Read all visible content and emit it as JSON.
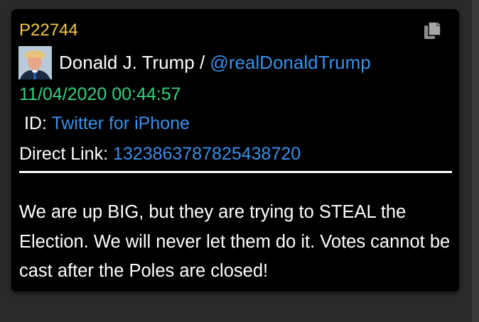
{
  "post": {
    "id": "P22744",
    "author_name": "Donald J. Trump",
    "author_separator": " / ",
    "handle": "@realDonaldTrump",
    "timestamp": "11/04/2020 00:44:57",
    "id_label": " ID: ",
    "id_value": "Twitter for iPhone",
    "direct_link_label": "Direct Link: ",
    "direct_link_value": "1323863787825438720",
    "body": "We are up BIG, but they are trying to STEAL the Election. We will never let them do it. Votes cannot be cast after the Poles are closed!"
  },
  "icons": {
    "copy": "copy-icon",
    "avatar": "avatar"
  },
  "colors": {
    "post_id": "#f2c94c",
    "timestamp": "#35d07f",
    "link": "#3b8fe8",
    "card_bg": "#000000",
    "page_bg": "#2a2a2a"
  }
}
